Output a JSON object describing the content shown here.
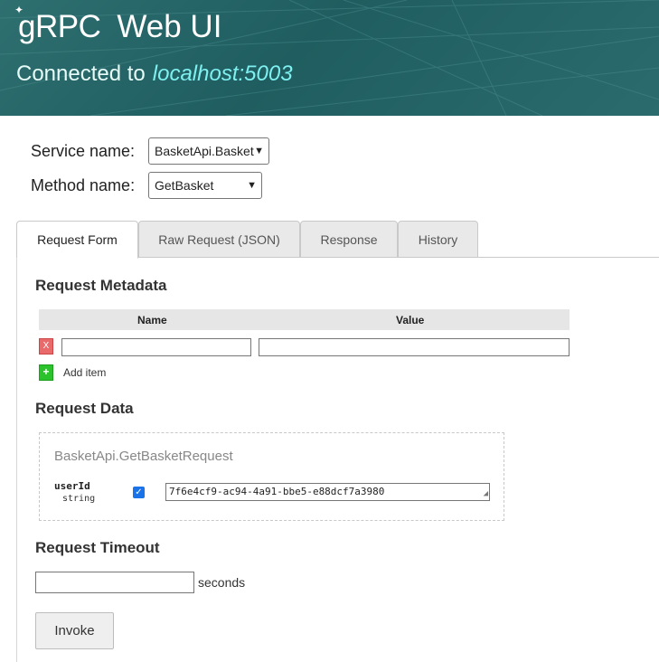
{
  "header": {
    "logo_text": "gRPC",
    "app_title": "Web UI",
    "connected_label": "Connected to",
    "host": "localhost:5003"
  },
  "service": {
    "label": "Service name:",
    "value": "BasketApi.Basket"
  },
  "method": {
    "label": "Method name:",
    "value": "GetBasket"
  },
  "tabs": [
    {
      "label": "Request Form",
      "active": true
    },
    {
      "label": "Raw Request (JSON)",
      "active": false
    },
    {
      "label": "Response",
      "active": false
    },
    {
      "label": "History",
      "active": false
    }
  ],
  "metadata": {
    "title": "Request Metadata",
    "col_name": "Name",
    "col_value": "Value",
    "remove_label": "X",
    "add_symbol": "+",
    "add_label": "Add item"
  },
  "request_data": {
    "title": "Request Data",
    "message_type": "BasketApi.GetBasketRequest",
    "field_name": "userId",
    "field_type": "string",
    "field_value": "7f6e4cf9-ac94-4a91-bbe5-e88dcf7a3980"
  },
  "timeout": {
    "title": "Request Timeout",
    "unit": "seconds",
    "value": ""
  },
  "invoke_label": "Invoke",
  "colors": {
    "header_bg": "#26676a",
    "host_color": "#7ff0f0",
    "remove_btn": "#e86a6a",
    "add_btn": "#2bc22b",
    "checkbox": "#1a73e8"
  }
}
